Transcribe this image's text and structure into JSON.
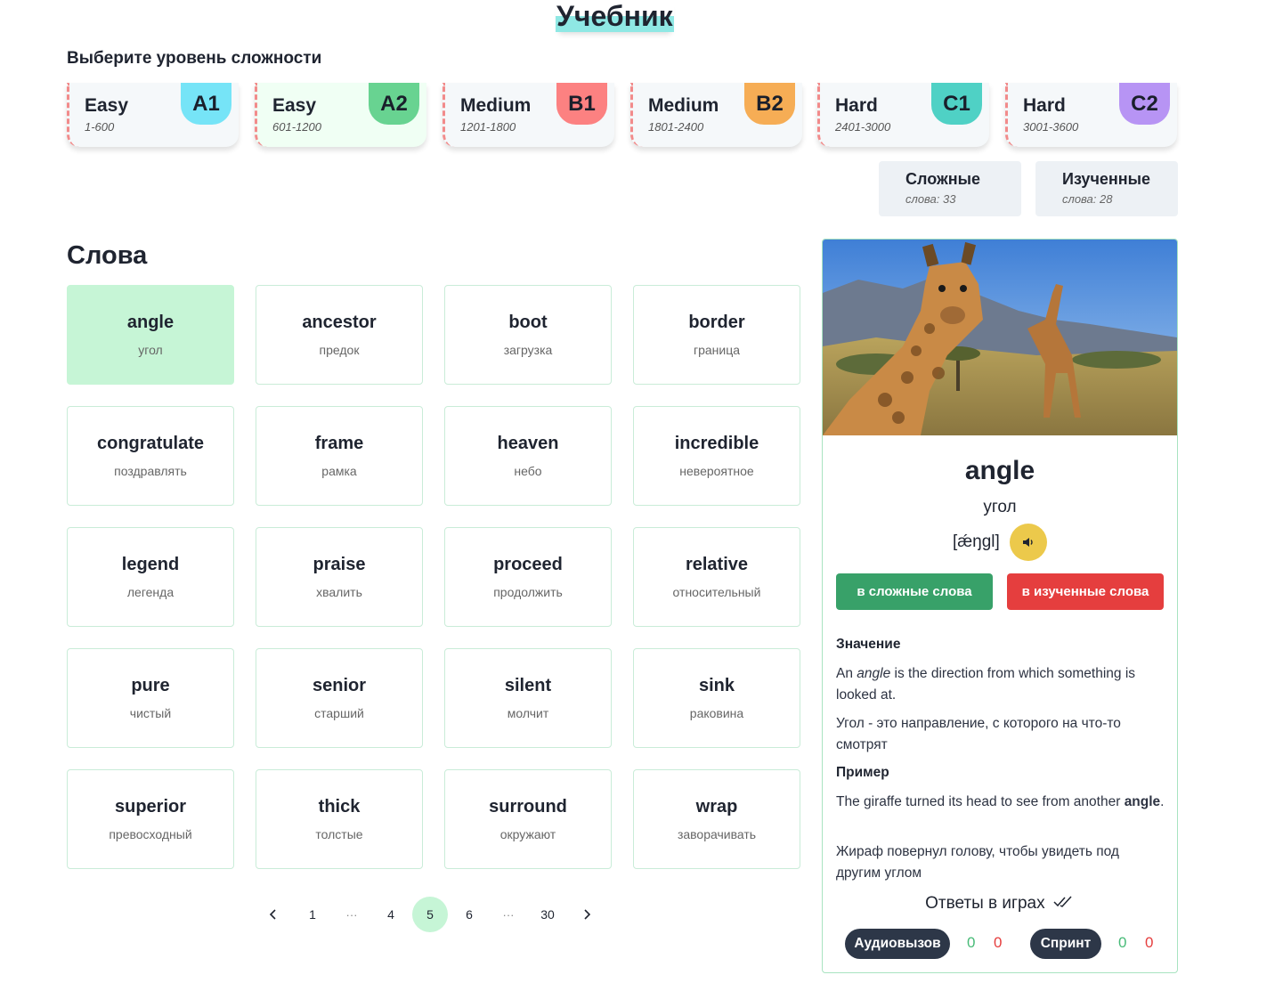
{
  "page": {
    "title": "Учебник",
    "level_heading": "Выберите уровень сложности",
    "words_heading": "Слова"
  },
  "levels": [
    {
      "name": "Easy",
      "range": "1-600",
      "code": "A1",
      "badge_color": "#76e4f7",
      "bg": "#f5f8fa"
    },
    {
      "name": "Easy",
      "range": "601-1200",
      "code": "A2",
      "badge_color": "#68d391",
      "bg": "#f0fff4"
    },
    {
      "name": "Medium",
      "range": "1201-1800",
      "code": "B1",
      "badge_color": "#fc8181",
      "bg": "#f5f8fa"
    },
    {
      "name": "Medium",
      "range": "1801-2400",
      "code": "B2",
      "badge_color": "#f6ad55",
      "bg": "#f5f8fa"
    },
    {
      "name": "Hard",
      "range": "2401-3000",
      "code": "C1",
      "badge_color": "#4fd1c5",
      "bg": "#f5f8fa"
    },
    {
      "name": "Hard",
      "range": "3001-3600",
      "code": "C2",
      "badge_color": "#b794f4",
      "bg": "#f5f8fa"
    }
  ],
  "special": [
    {
      "title": "Сложные",
      "count": "слова: 33"
    },
    {
      "title": "Изученные",
      "count": "слова: 28"
    }
  ],
  "words": [
    {
      "en": "angle",
      "ru": "угол",
      "active": true
    },
    {
      "en": "ancestor",
      "ru": "предок"
    },
    {
      "en": "boot",
      "ru": "загрузка"
    },
    {
      "en": "border",
      "ru": "граница"
    },
    {
      "en": "congratulate",
      "ru": "поздравлять"
    },
    {
      "en": "frame",
      "ru": "рамка"
    },
    {
      "en": "heaven",
      "ru": "небо"
    },
    {
      "en": "incredible",
      "ru": "невероятное"
    },
    {
      "en": "legend",
      "ru": "легенда"
    },
    {
      "en": "praise",
      "ru": "хвалить"
    },
    {
      "en": "proceed",
      "ru": "продолжить"
    },
    {
      "en": "relative",
      "ru": "относительный"
    },
    {
      "en": "pure",
      "ru": "чистый"
    },
    {
      "en": "senior",
      "ru": "старший"
    },
    {
      "en": "silent",
      "ru": "молчит"
    },
    {
      "en": "sink",
      "ru": "раковина"
    },
    {
      "en": "superior",
      "ru": "превосходный"
    },
    {
      "en": "thick",
      "ru": "толстые"
    },
    {
      "en": "surround",
      "ru": "окружают"
    },
    {
      "en": "wrap",
      "ru": "заворачивать"
    }
  ],
  "pagination": {
    "items": [
      "1",
      "···",
      "4",
      "5",
      "6",
      "···",
      "30"
    ],
    "current": "5"
  },
  "detail": {
    "word": "angle",
    "translation": "угол",
    "transcription": "[ǽŋgl]",
    "btn_hard": "в сложные слова",
    "btn_learned": "в изученные слова",
    "meaning_label": "Значение",
    "meaning_pre": "An ",
    "meaning_word": "angle",
    "meaning_post": " is the direction from which something is looked at.",
    "meaning_ru": "Угол - это направление, с которого на что-то смотрят",
    "example_label": "Пример",
    "example_pre": "The giraffe turned its head to see from another ",
    "example_word": "angle",
    "example_post": ".",
    "example_ru": "Жираф повернул голову, чтобы увидеть под другим углом",
    "answers_title": "Ответы в играх",
    "games": [
      {
        "name": "Аудиовызов",
        "right": "0",
        "wrong": "0"
      },
      {
        "name": "Спринт",
        "right": "0",
        "wrong": "0"
      }
    ]
  }
}
